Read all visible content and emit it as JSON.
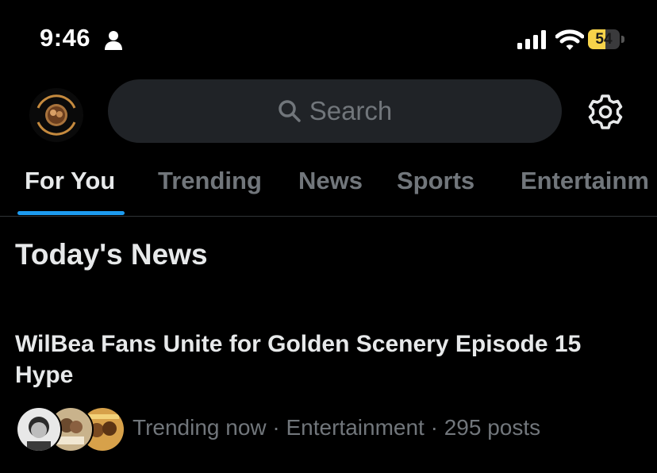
{
  "status": {
    "time": "9:46",
    "battery": "54",
    "battery_level": 0.54
  },
  "header": {
    "avatar_icon": "profile-avatar-icon",
    "search_placeholder": "Search",
    "settings_icon": "gear-icon"
  },
  "tabs": [
    {
      "label": "For You",
      "active": true
    },
    {
      "label": "Trending",
      "active": false
    },
    {
      "label": "News",
      "active": false
    },
    {
      "label": "Sports",
      "active": false
    },
    {
      "label": "Entertainm",
      "active": false
    }
  ],
  "section": {
    "title": "Today's News"
  },
  "news": {
    "headline": "WilBea Fans Unite for Golden Scenery Episode 15 Hype",
    "meta": "Trending now · Entertainment · 295 posts"
  },
  "colors": {
    "background": "#000000",
    "accent": "#1d9bf0",
    "battery": "#f7d34a",
    "muted_text": "#71767b"
  }
}
